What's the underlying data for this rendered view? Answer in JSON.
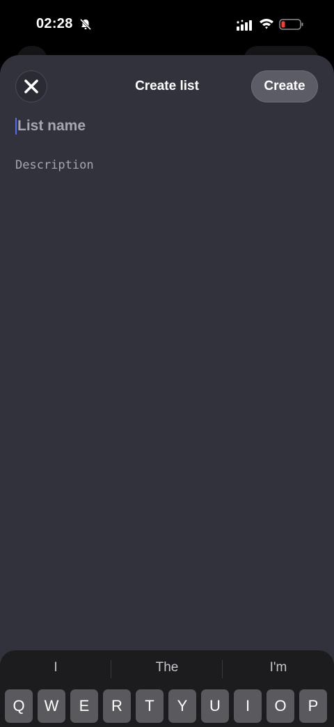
{
  "status_bar": {
    "time": "02:28",
    "icons": [
      "bell-slash-icon",
      "cellular-signal-icon",
      "wifi-icon",
      "battery-low-icon"
    ],
    "battery_color": "#ff3b30"
  },
  "sheet": {
    "title": "Create list",
    "close_icon": "close-icon",
    "create_label": "Create",
    "list_name_placeholder": "List name",
    "description_placeholder": "Description"
  },
  "keyboard": {
    "suggestions": [
      "I",
      "The",
      "I'm"
    ],
    "top_row": [
      "Q",
      "W",
      "E",
      "R",
      "T",
      "Y",
      "U",
      "I",
      "O",
      "P"
    ]
  },
  "colors": {
    "sheet_background": "#31323b",
    "cursor_accent": "#4e6ef2"
  }
}
